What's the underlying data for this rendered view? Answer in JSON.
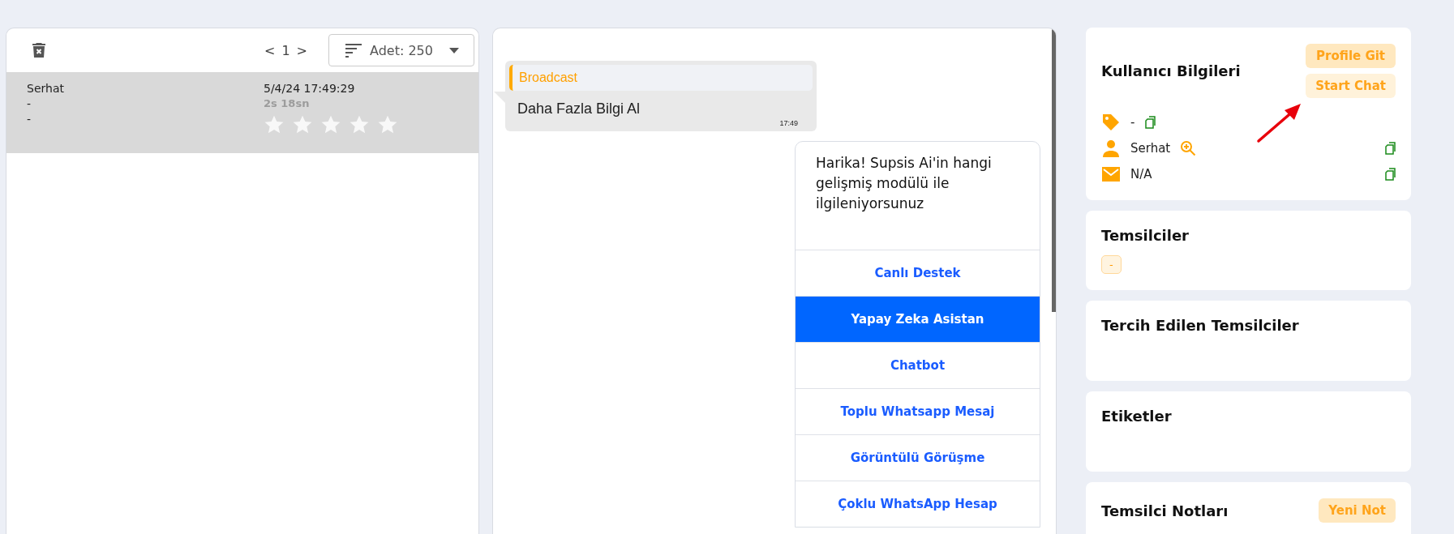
{
  "list_panel": {
    "pagination": {
      "prev": "<",
      "page": "1",
      "next": ">"
    },
    "page_size": "Adet: 250",
    "conversations": [
      {
        "name": "Serhat",
        "line_2": "-",
        "line_3": "-",
        "time": "5/4/24 17:49:29",
        "duration": "2s 18sn",
        "stars": 0,
        "selected": true
      }
    ]
  },
  "chat": {
    "messages": [
      {
        "kind": "broadcast",
        "tag": "Broadcast",
        "text": "Daha Fazla Bilgi Al",
        "time": "17:49"
      },
      {
        "kind": "options",
        "text": "Harika! Supsis Ai'in hangi gelişmiş modülü ile ilgileniyorsunuz",
        "options": [
          {
            "label": "Canlı Destek",
            "selected": false
          },
          {
            "label": "Yapay Zeka Asistan",
            "selected": true
          },
          {
            "label": "Chatbot",
            "selected": false
          },
          {
            "label": "Toplu Whatsapp Mesaj",
            "selected": false
          },
          {
            "label": "Görüntülü Görüşme",
            "selected": false
          },
          {
            "label": "Çoklu WhatsApp Hesap",
            "selected": false
          }
        ]
      }
    ]
  },
  "user_info": {
    "title": "Kullanıcı Bilgileri",
    "buttons": [
      {
        "label": "Profile Git"
      },
      {
        "label": "Start Chat"
      }
    ],
    "fields": [
      {
        "kind": "tag",
        "value": "-"
      },
      {
        "kind": "person",
        "value": "Serhat"
      },
      {
        "kind": "email",
        "value": "N/A"
      }
    ]
  },
  "representatives": {
    "title": "Temsilciler",
    "chips": [
      "-"
    ]
  },
  "preferred_representatives": {
    "title": "Tercih Edilen Temsilciler"
  },
  "tags": {
    "title": "Etiketler"
  },
  "notes": {
    "title": "Temsilci Notları",
    "button": "Yeni Not"
  }
}
